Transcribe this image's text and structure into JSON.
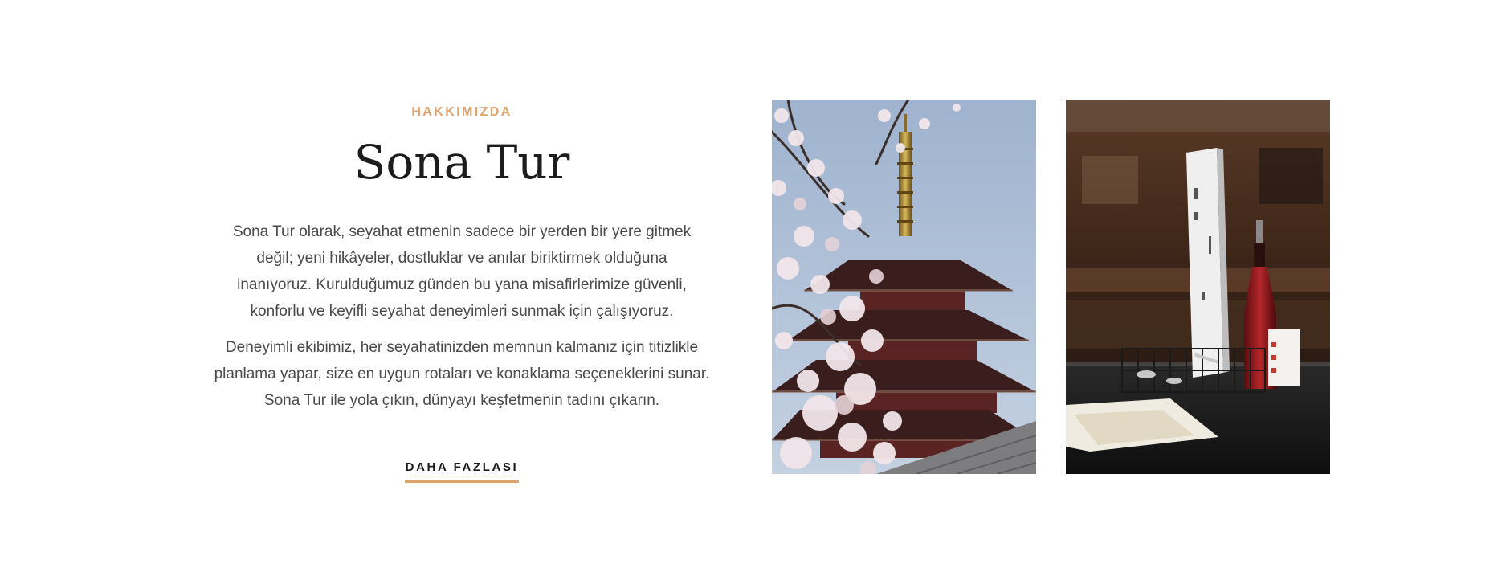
{
  "about": {
    "eyebrow": "HAKKIMIZDA",
    "title": "Sona Tur",
    "paragraphs": [
      "Sona Tur olarak, seyahat etmenin sadece bir yerden bir yere gitmek değil; yeni hikâyeler, dostluklar ve anılar biriktirmek olduğuna inanıyoruz. Kurulduğumuz günden bu yana misafirlerimize güvenli, konforlu ve keyifli seyahat deneyimleri sunmak için çalışıyoruz.",
      "Deneyimli ekibimiz, her seyahatinizden memnun kalmanız için titizlikle planlama yapar, size en uygun rotaları ve konaklama seçeneklerini sunar. Sona Tur ile yola çıkın, dünyayı keşfetmenin tadını çıkarın."
    ],
    "more_label": "DAHA FAZLASI"
  },
  "colors": {
    "accent": "#dfa36c",
    "heading": "#1c1c1c",
    "body_text": "#4a4a4a",
    "background": "#ffffff"
  },
  "images": [
    {
      "subject": "pagoda-with-cherry-blossoms"
    },
    {
      "subject": "cafe-table-with-menu-and-condiments"
    }
  ]
}
